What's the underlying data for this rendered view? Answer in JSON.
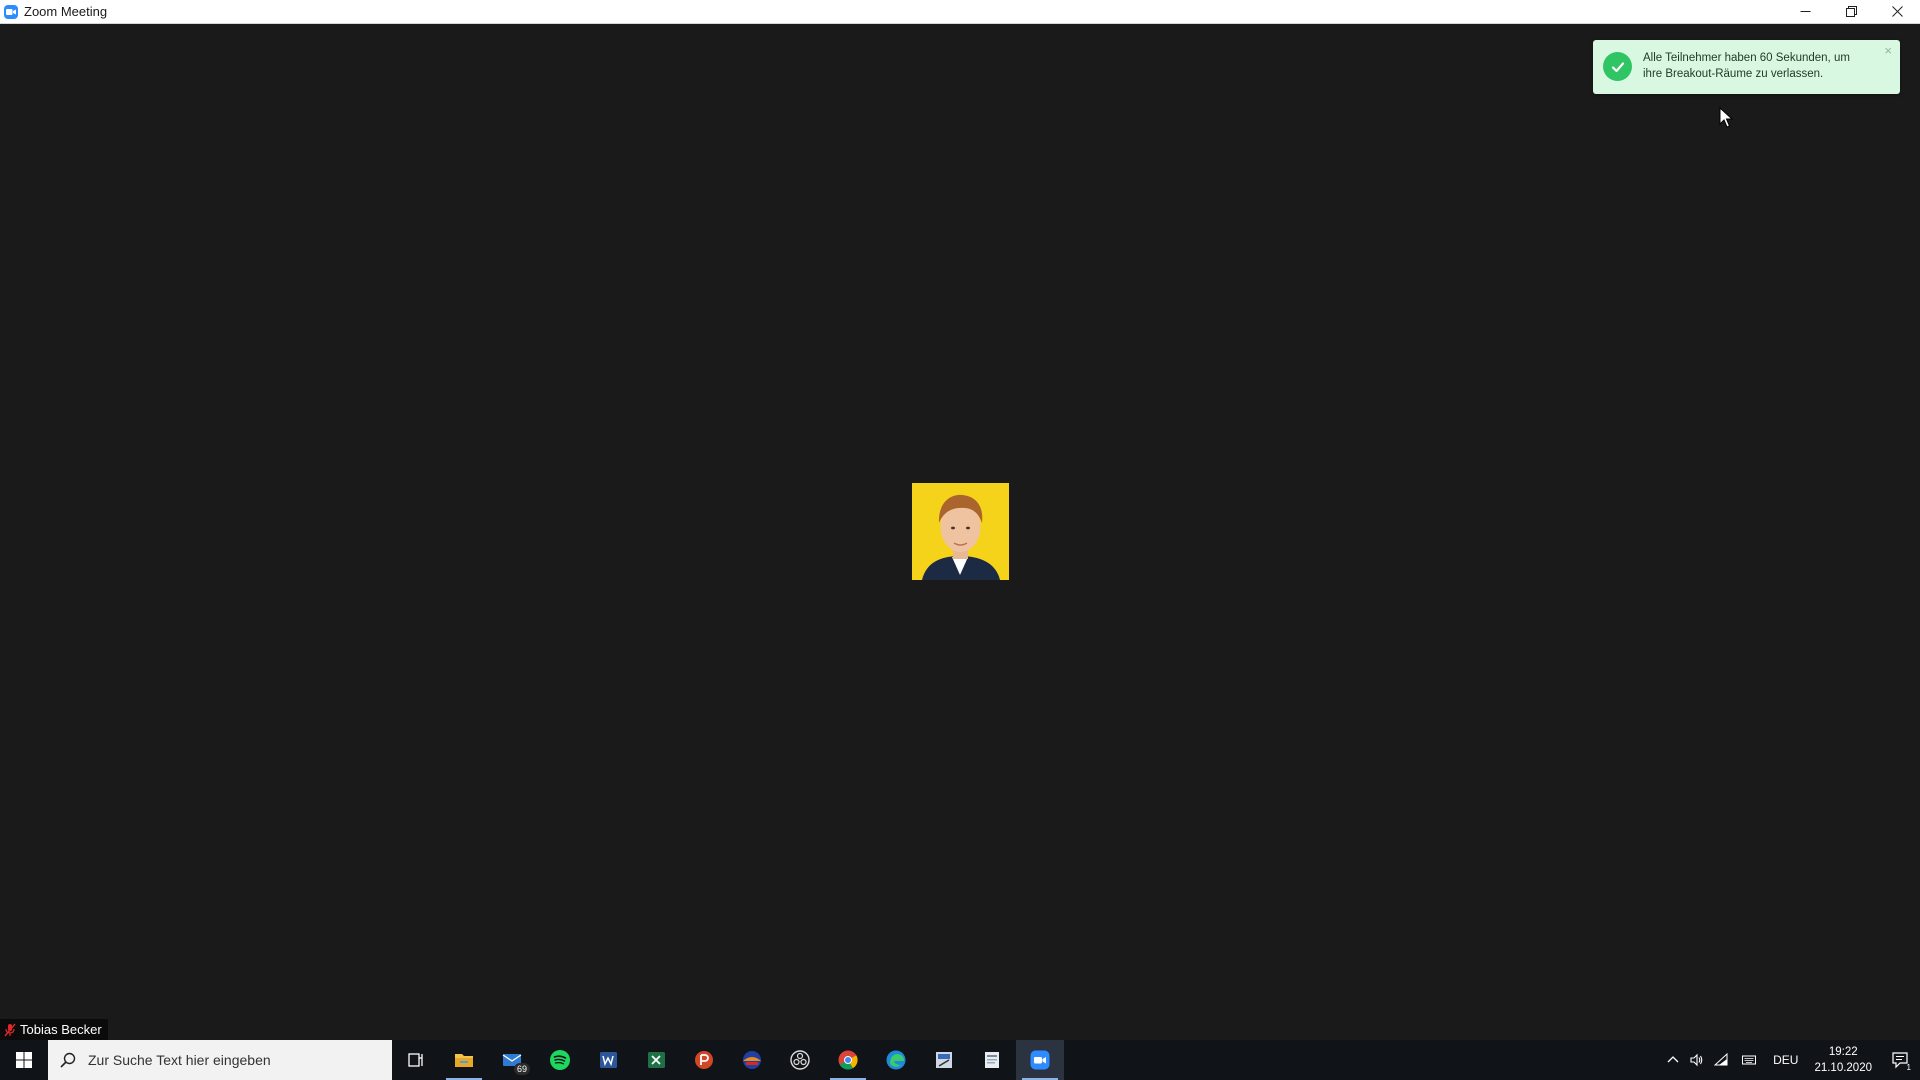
{
  "window": {
    "title": "Zoom Meeting"
  },
  "notification": {
    "message": "Alle Teilnehmer haben 60 Sekunden, um ihre Breakout-Räume zu verlassen.",
    "close": "×"
  },
  "participant": {
    "name": "Tobias Becker"
  },
  "taskbar": {
    "search_placeholder": "Zur Suche Text hier eingeben",
    "mail_badge": "69",
    "language": "DEU",
    "time": "19:22",
    "date": "21.10.2020",
    "notification_count": "1"
  },
  "colors": {
    "meeting_background": "#1a1a1a",
    "toast_background": "#d9f8e2",
    "toast_check": "#2fc464",
    "avatar_background": "#f5d31a",
    "taskbar": "#101418"
  }
}
